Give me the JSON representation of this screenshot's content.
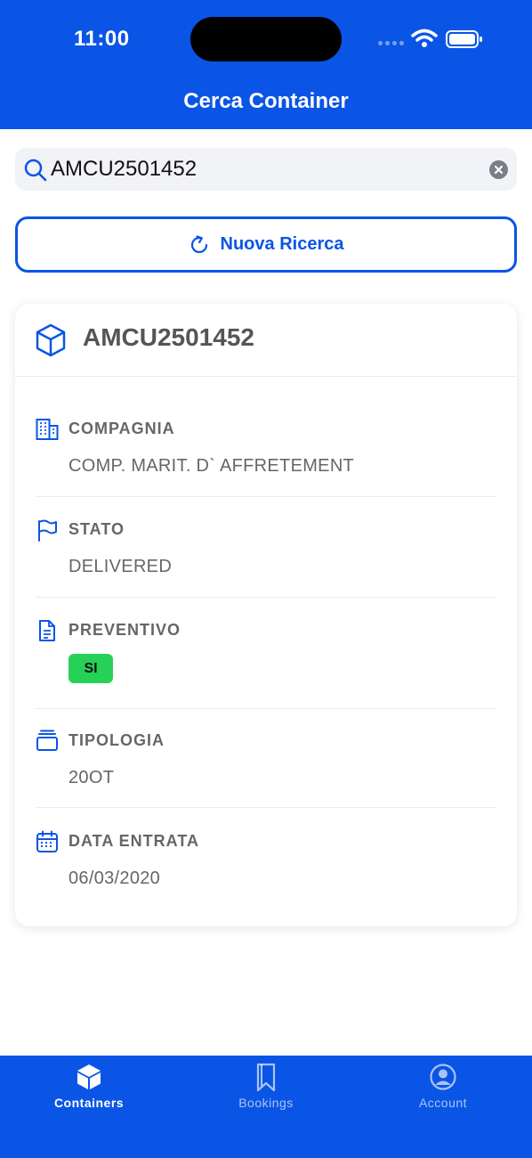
{
  "status_bar": {
    "time": "11:00"
  },
  "nav": {
    "title": "Cerca Container"
  },
  "search": {
    "value": "AMCU2501452"
  },
  "new_search_button": {
    "label": "Nuova Ricerca"
  },
  "container": {
    "code": "AMCU2501452",
    "fields": {
      "compagnia": {
        "label": "COMPAGNIA",
        "value": "COMP. MARIT. D` AFFRETEMENT"
      },
      "stato": {
        "label": "STATO",
        "value": "DELIVERED"
      },
      "preventivo": {
        "label": "PREVENTIVO",
        "badge": "SI"
      },
      "tipologia": {
        "label": "TIPOLOGIA",
        "value": "20OT"
      },
      "data_entrata": {
        "label": "DATA ENTRATA",
        "value": "06/03/2020"
      }
    }
  },
  "tabbar": {
    "tabs": [
      {
        "label": "Containers",
        "icon": "cube-icon",
        "active": true
      },
      {
        "label": "Bookings",
        "icon": "bookmark-icon",
        "active": false
      },
      {
        "label": "Account",
        "icon": "person-circle-icon",
        "active": false
      }
    ]
  },
  "colors": {
    "primary": "#0a55e6",
    "badge_green": "#27d157"
  }
}
